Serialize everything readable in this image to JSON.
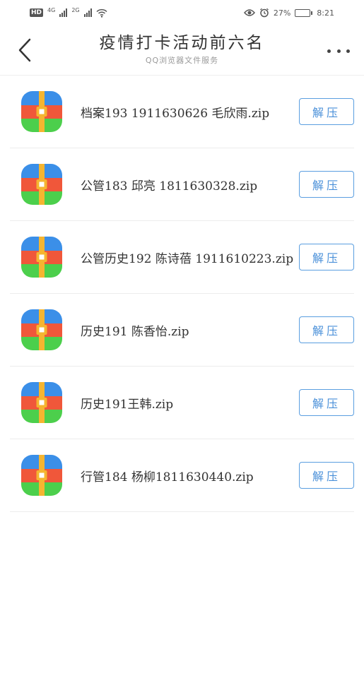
{
  "status_bar": {
    "hd": "HD",
    "net1": "4G",
    "net2": "2G",
    "battery_pct": "27%",
    "time": "8:21"
  },
  "header": {
    "title": "疫情打卡活动前六名",
    "subtitle": "QQ浏览器文件服务"
  },
  "files": [
    {
      "name": "档案193 1911630626 毛欣雨.zip",
      "action": "解压"
    },
    {
      "name": "公管183 邱亮 1811630328.zip",
      "action": "解压"
    },
    {
      "name": "公管历史192 陈诗蓓 1911610223.zip",
      "action": "解压"
    },
    {
      "name": "历史191 陈香怡.zip",
      "action": "解压"
    },
    {
      "name": "历史191王韩.zip",
      "action": "解压"
    },
    {
      "name": "行管184 杨柳1811630440.zip",
      "action": "解压"
    }
  ],
  "colors": {
    "accent": "#4a90d9",
    "icon_blue": "#3b8fe8",
    "icon_red": "#f0573a",
    "icon_green": "#4ccf4c",
    "icon_strap": "#f5b530"
  }
}
